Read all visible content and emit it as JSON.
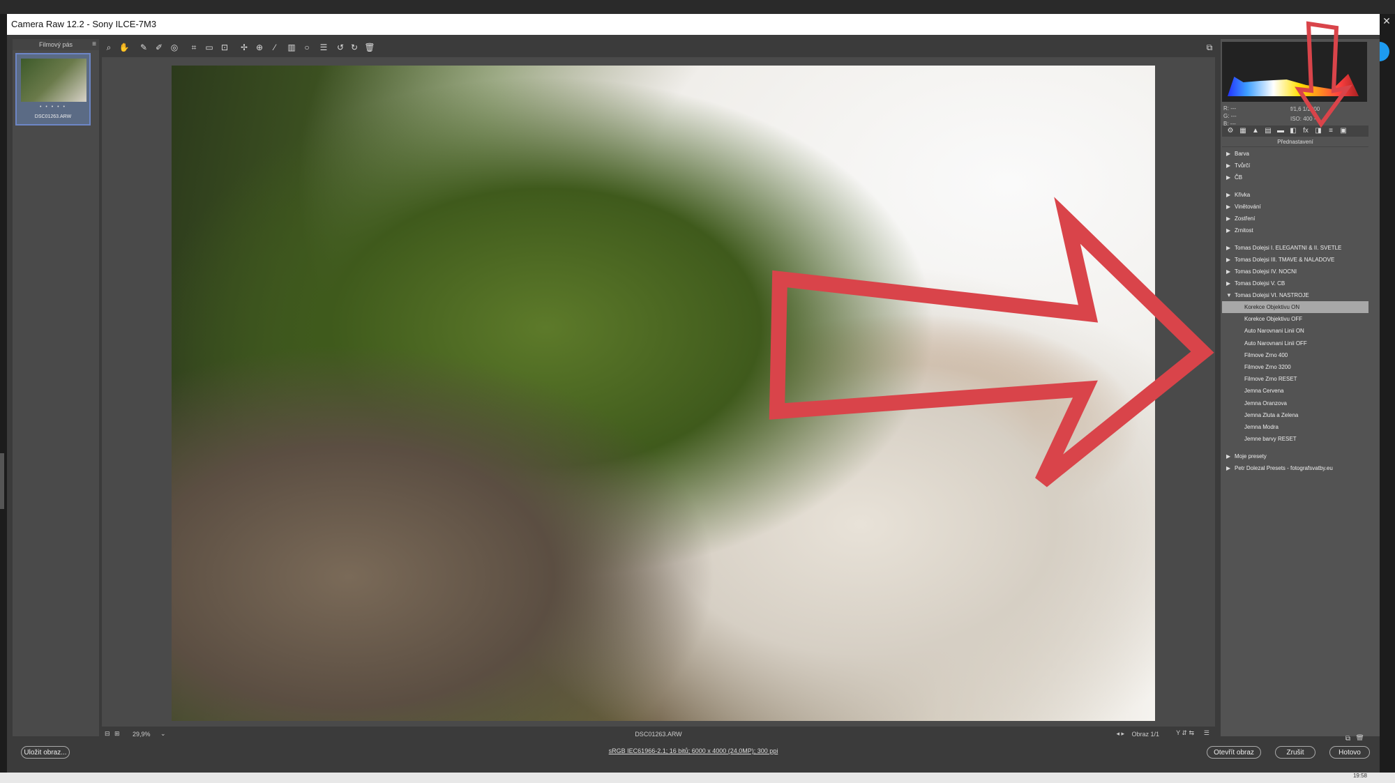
{
  "window": {
    "title": "Camera Raw 12.2  -  Sony ILCE-7M3",
    "close": "✕"
  },
  "filmstrip": {
    "title": "Filmový pás",
    "menu": "≡",
    "thumb": {
      "stars": "• • • • •",
      "name": "DSC01263.ARW"
    }
  },
  "toolbar": {
    "icons": [
      "zoom-icon",
      "hand-icon",
      "white-balance-icon",
      "color-sampler-icon",
      "target-adjust-icon",
      "crop-icon",
      "straighten-icon",
      "transform-icon",
      "spot-removal-icon",
      "red-eye-icon",
      "adjustment-brush-icon",
      "graduated-filter-icon",
      "radial-filter-icon",
      "presets-list-icon",
      "rotate-ccw-icon",
      "rotate-cw-icon",
      "delete-icon"
    ],
    "fullscreen": "⧉"
  },
  "bottombar": {
    "zoom": "29,9%",
    "filename": "DSC01263.ARW",
    "page": "Obraz 1/1"
  },
  "histogram": {
    "rgb": [
      "R:  ---",
      "G:  ---",
      "B:  ---"
    ],
    "exif": [
      "f/1,6   1/2000",
      "ISO: 400   ---"
    ]
  },
  "tabs": [
    "⚙",
    "▦",
    "▲",
    "▤",
    "▬",
    "◧",
    "fx",
    "◨",
    "≡",
    "▣"
  ],
  "presets": {
    "header": "Přednastavení",
    "groups1": [
      "Barva",
      "Tvůrčí",
      "ČB"
    ],
    "groups2": [
      "Křivka",
      "Vinětování",
      "Zostření",
      "Zrnitost"
    ],
    "groups3": [
      "Tomas Dolejsi   I. ELEGANTNI & II. SVETLE",
      "Tomas Dolejsi   III. TMAVE & NALADOVE",
      "Tomas Dolejsi   IV. NOCNI",
      "Tomas Dolejsi   V. CB"
    ],
    "open_group": "Tomas Dolejsi   VI. NASTROJE",
    "open_items": [
      "Korekce Objektivu ON",
      "Korekce Objektivu OFF",
      "Auto Narovnani Linii ON",
      "Auto Narovnani Linii OFF",
      "Filmove Zrno 400",
      "Filmove Zrno 3200",
      "Filmove Zrno RESET",
      "Jemna Cervena",
      "Jemna Oranzova",
      "Jemna Zluta a Zelena",
      "Jemna Modra",
      "Jemne barvy RESET"
    ],
    "selected_index": 0,
    "groups4": [
      "Moje presety",
      "Petr Dolezal Presets - fotografsvatby.eu"
    ]
  },
  "footer": {
    "save": "Uložit obraz...",
    "info": "sRGB IEC61966-2.1; 16 bitů; 6000 x 4000 (24,0MP); 300 ppi",
    "open": "Otevřít obraz",
    "cancel": "Zrušit",
    "done": "Hotovo"
  },
  "taskbar": {
    "clock": "19:58"
  },
  "annotation_color": "#d9444a"
}
